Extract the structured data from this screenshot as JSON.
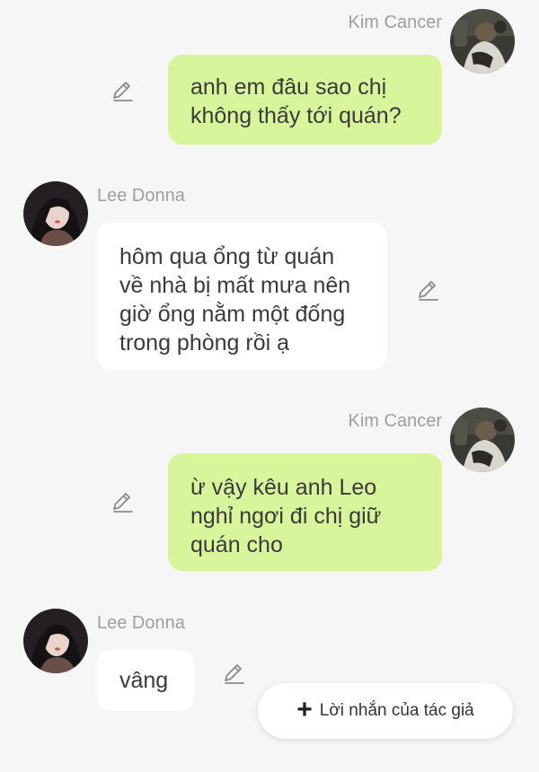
{
  "messages": [
    {
      "sender": "Kim Cancer",
      "side": "right",
      "avatar_icon": "kim-cancer-avatar",
      "lines": [
        "anh em đâu sao chị",
        "không thấy tới quán?"
      ]
    },
    {
      "sender": "Lee Donna",
      "side": "left",
      "avatar_icon": "lee-donna-avatar",
      "lines": [
        "hôm qua ổng từ quán",
        "về nhà bị mất mưa nên",
        "giờ ổng nằm một đống",
        "trong phòng rồi ạ"
      ]
    },
    {
      "sender": "Kim Cancer",
      "side": "right",
      "avatar_icon": "kim-cancer-avatar",
      "lines": [
        "ừ vậy kêu anh Leo",
        "nghỉ ngơi đi chị giữ",
        "quán cho"
      ]
    },
    {
      "sender": "Lee Donna",
      "side": "left",
      "avatar_icon": "lee-donna-avatar",
      "lines": [
        "vâng"
      ]
    }
  ],
  "fab": {
    "icon": "plus-icon",
    "label": "Lời nhắn của tác giả"
  },
  "colors": {
    "background": "#f6f6f6",
    "my_bubble": "#d8f59c",
    "their_bubble": "#ffffff",
    "name_text": "#9e9e9e",
    "message_text": "#3a3a3a"
  }
}
